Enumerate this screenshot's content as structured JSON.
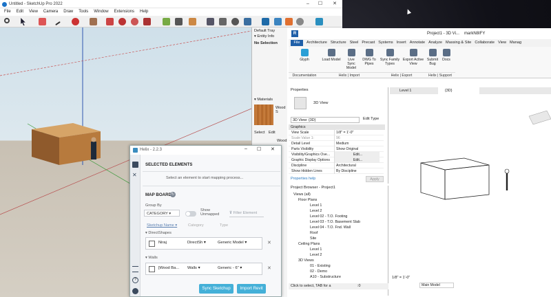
{
  "colors": {
    "revit_blue": "#1f5fa8",
    "helix_btn": "#44b0d8",
    "wall_wood": "#b77a3d"
  },
  "sketchup": {
    "title": "Untitled - SketchUp Pro 2022",
    "menu": [
      "File",
      "Edit",
      "View",
      "Camera",
      "Draw",
      "Tools",
      "Window",
      "Extensions",
      "Help"
    ],
    "tray_title": "Default Tray",
    "entity_info": "Entity Info",
    "no_selection": "No Selection",
    "materials": "Materials",
    "material_name": "Wood S",
    "select_tab": "Select",
    "edit_tab": "Edit",
    "wood_label": "Wood"
  },
  "revit": {
    "title": "Project1 - 3D Vi...",
    "user": "markN8IFY",
    "tabs": [
      "File",
      "Architecture",
      "Structure",
      "Steel",
      "Precast",
      "Systems",
      "Insert",
      "Annotate",
      "Analyze",
      "Massing & Site",
      "Collaborate",
      "View",
      "Manag"
    ],
    "ribbon_buttons": [
      {
        "label": "Glyph",
        "icon": "glyph-icon"
      },
      {
        "label": "Load Model",
        "icon": "load-model-icon"
      },
      {
        "label": "Live Sync Model",
        "icon": "live-sync-icon"
      },
      {
        "label": "DWG To Pipes",
        "icon": "dwg-icon"
      },
      {
        "label": "Sync Family Types",
        "icon": "sync-family-icon"
      },
      {
        "label": "Export Active View",
        "icon": "export-view-icon"
      },
      {
        "label": "Submit Bug",
        "icon": "bug-icon"
      },
      {
        "label": "Docs",
        "icon": "docs-icon"
      }
    ],
    "ribbon_groups": [
      "Documentation",
      "Helix | Import",
      "Helix | Export",
      "Helix | Support"
    ],
    "properties_title": "Properties",
    "type_name": "3D View",
    "view_selector": "3D View: {3D}",
    "edit_type": "Edit Type",
    "graphics_header": "Graphics",
    "props": [
      {
        "k": "View Scale",
        "v": "1/8\" = 1'-0\""
      },
      {
        "k": "Scale Value   1:",
        "v": "96"
      },
      {
        "k": "Detail Level",
        "v": "Medium"
      },
      {
        "k": "Parts Visibility",
        "v": "Show Original"
      },
      {
        "k": "Visibility/Graphics Ove...",
        "v": "Edit..."
      },
      {
        "k": "Graphic Display Options",
        "v": "Edit..."
      },
      {
        "k": "Discipline",
        "v": "Architectural"
      },
      {
        "k": "Show Hidden Lines",
        "v": "By Discipline"
      }
    ],
    "properties_help": "Properties help",
    "apply": "Apply",
    "browser_title": "Project Browser - Project1",
    "tree": [
      {
        "t": "Views (all)",
        "d": 0
      },
      {
        "t": "Floor Plans",
        "d": 1
      },
      {
        "t": "Level 1",
        "d": 2
      },
      {
        "t": "Level 2",
        "d": 2
      },
      {
        "t": "Level 02 - T.O. Footing",
        "d": 2
      },
      {
        "t": "Level 03 - T.O. Basement Slab",
        "d": 2
      },
      {
        "t": "Level 04 - T.O. Fnd. Wall",
        "d": 2
      },
      {
        "t": "Roof",
        "d": 2
      },
      {
        "t": "Site",
        "d": 2
      },
      {
        "t": "Ceiling Plans",
        "d": 1
      },
      {
        "t": "Level 1",
        "d": 2
      },
      {
        "t": "Level 2",
        "d": 2
      },
      {
        "t": "3D Views",
        "d": 1
      },
      {
        "t": "01 - Existing",
        "d": 2
      },
      {
        "t": "02 - Demo",
        "d": 2
      },
      {
        "t": "A10 - Substructure",
        "d": 2
      }
    ],
    "view_tabs": [
      "Level 1",
      "{3D}"
    ],
    "status": "Click to select, TAB for a",
    "scale_footer": "1/8\" = 1'-0\"",
    "main_model": "Main Model",
    "zero": ":0"
  },
  "helix": {
    "title": "Helix - 2.2.3",
    "selected_elements": "SELECTED ELEMENTS",
    "select_prompt": "Select an element to start mapping process...",
    "map_board": "MAP BOARD",
    "group_by_label": "Group By",
    "group_by_value": "CATEGORY",
    "show_unmapped": "Show Unmapped",
    "filter_placeholder": "Filter Element",
    "col_sketchup": "Sketchup Name",
    "col_category": "Category",
    "col_type": "Type",
    "groups": [
      {
        "name": "DirectShapes",
        "row": {
          "name": "Niraj",
          "category": "DirectSh",
          "type": "Generic Model"
        }
      },
      {
        "name": "Walls",
        "row": {
          "name": "[Wood Ba...",
          "category": "Walls",
          "type": "Generic - 6\""
        }
      }
    ],
    "sync_button": "Sync Sketchup",
    "import_button": "Import Revit"
  }
}
